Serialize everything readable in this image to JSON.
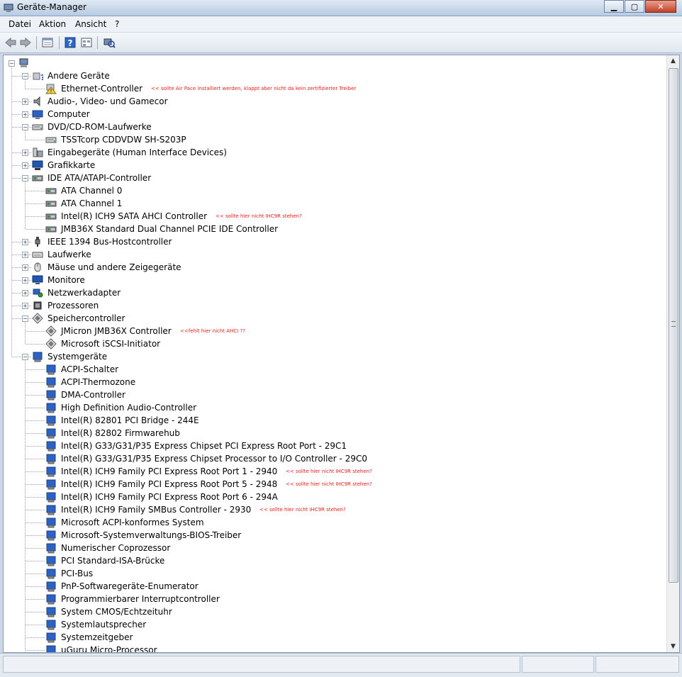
{
  "window": {
    "title": "Geräte-Manager",
    "icon": "device-manager-icon"
  },
  "menu": [
    "Datei",
    "Aktion",
    "Ansicht",
    "?"
  ],
  "toolbar": [
    "back-arrow-icon",
    "forward-arrow-icon",
    "properties-icon",
    "help-icon",
    "view-icon",
    "scan-hardware-icon"
  ],
  "colors": {
    "annotation": "#e0201c",
    "titlebar": "#c9d7e6",
    "selection": "#3399ff"
  },
  "tree": [
    {
      "level": 0,
      "label": "",
      "icon": "computer-root-icon",
      "expanded": true
    },
    {
      "level": 1,
      "label": "Andere Geräte",
      "icon": "unknown-device-icon",
      "expanded": true
    },
    {
      "level": 2,
      "label": "Ethernet-Controller",
      "icon": "warning-device-icon",
      "note": "<< sollte Air Pace installiert werden, klappt aber nicht da kein zertifizierter Treiber"
    },
    {
      "level": 1,
      "label": "Audio-, Video- und Gamecor",
      "icon": "speaker-icon",
      "expanded": false
    },
    {
      "level": 1,
      "label": "Computer",
      "icon": "computer-icon",
      "expanded": false
    },
    {
      "level": 1,
      "label": "DVD/CD-ROM-Laufwerke",
      "icon": "dvd-drive-icon",
      "expanded": true
    },
    {
      "level": 2,
      "label": "TSSTcorp CDDVDW SH-S203P",
      "icon": "dvd-drive-icon"
    },
    {
      "level": 1,
      "label": "Eingabegeräte (Human Interface Devices)",
      "icon": "input-device-icon",
      "expanded": false
    },
    {
      "level": 1,
      "label": "Grafikkarte",
      "icon": "display-adapter-icon",
      "expanded": false
    },
    {
      "level": 1,
      "label": "IDE ATA/ATAPI-Controller",
      "icon": "ide-controller-icon",
      "expanded": true
    },
    {
      "level": 2,
      "label": "ATA Channel 0",
      "icon": "ide-controller-icon"
    },
    {
      "level": 2,
      "label": "ATA Channel 1",
      "icon": "ide-controller-icon"
    },
    {
      "level": 2,
      "label": "Intel(R) ICH9 SATA AHCI Controller",
      "icon": "ide-controller-icon",
      "note": "<< sollte hier nicht IHC9R stehen?"
    },
    {
      "level": 2,
      "label": "JMB36X Standard Dual Channel PCIE IDE Controller",
      "icon": "ide-controller-icon"
    },
    {
      "level": 1,
      "label": "IEEE 1394 Bus-Hostcontroller",
      "icon": "firewire-icon",
      "expanded": false
    },
    {
      "level": 1,
      "label": "Laufwerke",
      "icon": "disk-drive-icon",
      "expanded": false
    },
    {
      "level": 1,
      "label": "Mäuse und andere Zeigegeräte",
      "icon": "mouse-icon",
      "expanded": false
    },
    {
      "level": 1,
      "label": "Monitore",
      "icon": "monitor-icon",
      "expanded": false
    },
    {
      "level": 1,
      "label": "Netzwerkadapter",
      "icon": "network-adapter-icon",
      "expanded": false
    },
    {
      "level": 1,
      "label": "Prozessoren",
      "icon": "processor-icon",
      "expanded": false
    },
    {
      "level": 1,
      "label": "Speichercontroller",
      "icon": "storage-controller-icon",
      "expanded": true
    },
    {
      "level": 2,
      "label": "JMicron JMB36X Controller",
      "icon": "storage-controller-icon",
      "note": "<<fehlt hier nicht AHCI ??"
    },
    {
      "level": 2,
      "label": "Microsoft iSCSI-Initiator",
      "icon": "storage-controller-icon"
    },
    {
      "level": 1,
      "label": "Systemgeräte",
      "icon": "system-device-icon",
      "expanded": true
    },
    {
      "level": 2,
      "label": "ACPI-Schalter",
      "icon": "system-device-icon"
    },
    {
      "level": 2,
      "label": "ACPI-Thermozone",
      "icon": "system-device-icon"
    },
    {
      "level": 2,
      "label": "DMA-Controller",
      "icon": "system-device-icon"
    },
    {
      "level": 2,
      "label": "High Definition Audio-Controller",
      "icon": "system-device-icon"
    },
    {
      "level": 2,
      "label": "Intel(R) 82801 PCI Bridge - 244E",
      "icon": "system-device-icon"
    },
    {
      "level": 2,
      "label": "Intel(R) 82802 Firmwarehub",
      "icon": "system-device-icon"
    },
    {
      "level": 2,
      "label": "Intel(R) G33/G31/P35 Express Chipset PCI Express Root Port - 29C1",
      "icon": "system-device-icon"
    },
    {
      "level": 2,
      "label": "Intel(R) G33/G31/P35 Express Chipset Processor to I/O Controller - 29C0",
      "icon": "system-device-icon"
    },
    {
      "level": 2,
      "label": "Intel(R) ICH9 Family PCI Express Root Port 1 - 2940",
      "icon": "system-device-icon",
      "note": "<< sollte hier nicht IHC9R stehen?"
    },
    {
      "level": 2,
      "label": "Intel(R) ICH9 Family PCI Express Root Port 5 - 2948",
      "icon": "system-device-icon",
      "note": "<< sollte hier nicht IHC9R stehen?"
    },
    {
      "level": 2,
      "label": "Intel(R) ICH9 Family PCI Express Root Port 6 - 294A",
      "icon": "system-device-icon"
    },
    {
      "level": 2,
      "label": "Intel(R) ICH9 Family SMBus Controller - 2930",
      "icon": "system-device-icon",
      "note": "<< sollte hier nicht IHC9R stehen?"
    },
    {
      "level": 2,
      "label": "Microsoft ACPI-konformes System",
      "icon": "system-device-icon"
    },
    {
      "level": 2,
      "label": "Microsoft-Systemverwaltungs-BIOS-Treiber",
      "icon": "system-device-icon"
    },
    {
      "level": 2,
      "label": "Numerischer Coprozessor",
      "icon": "system-device-icon"
    },
    {
      "level": 2,
      "label": "PCI Standard-ISA-Brücke",
      "icon": "system-device-icon"
    },
    {
      "level": 2,
      "label": "PCI-Bus",
      "icon": "system-device-icon"
    },
    {
      "level": 2,
      "label": "PnP-Softwaregeräte-Enumerator",
      "icon": "system-device-icon"
    },
    {
      "level": 2,
      "label": "Programmierbarer Interruptcontroller",
      "icon": "system-device-icon"
    },
    {
      "level": 2,
      "label": "System CMOS/Echtzeituhr",
      "icon": "system-device-icon"
    },
    {
      "level": 2,
      "label": "Systemlautsprecher",
      "icon": "system-device-icon"
    },
    {
      "level": 2,
      "label": "Systemzeitgeber",
      "icon": "system-device-icon"
    },
    {
      "level": 2,
      "label": "uGuru Micro-Processor",
      "icon": "system-device-icon"
    }
  ]
}
